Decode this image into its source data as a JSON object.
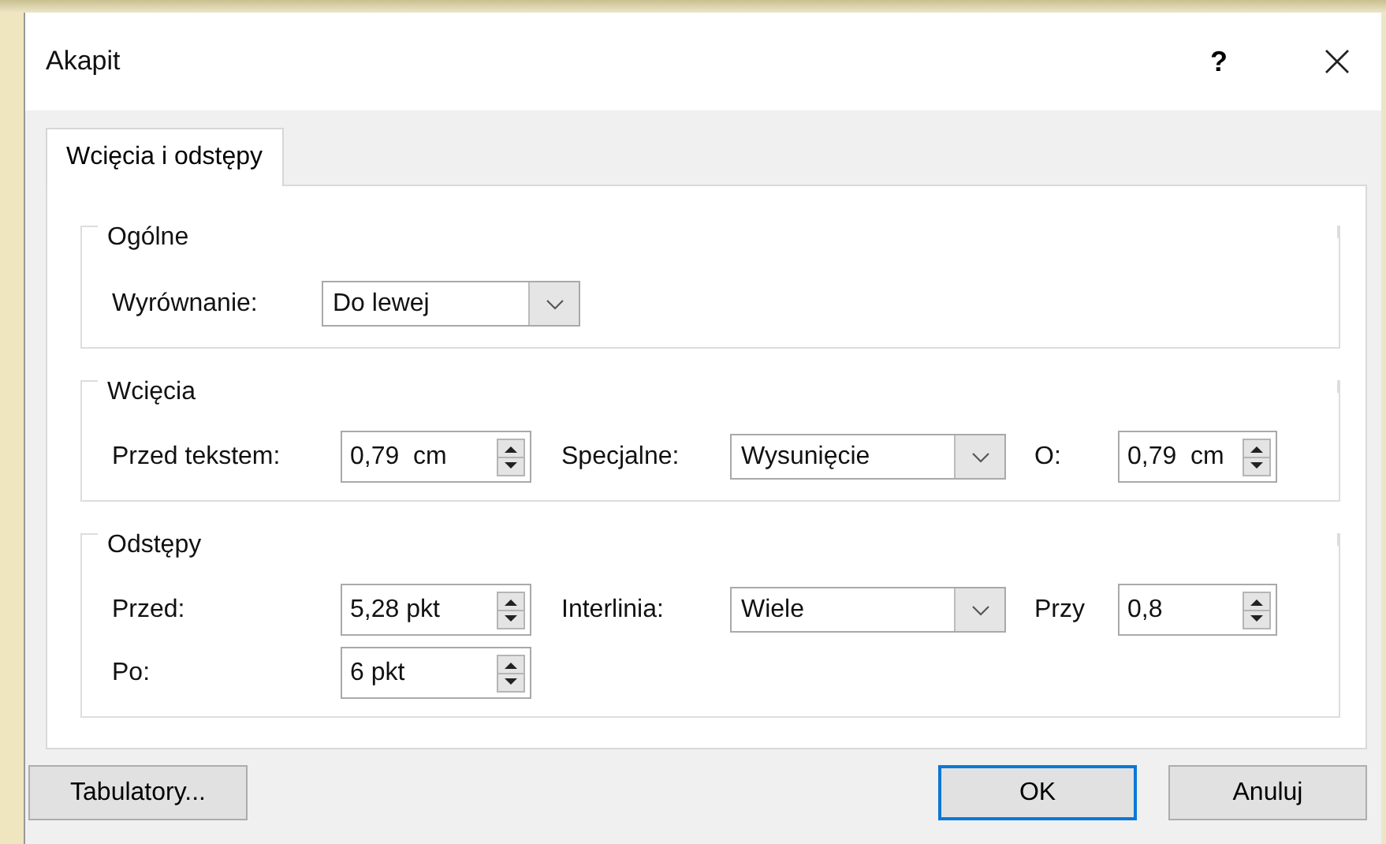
{
  "window": {
    "title": "Akapit",
    "help": "?"
  },
  "tabs": [
    {
      "label": "Wcięcia i odstępy",
      "selected": true
    }
  ],
  "groups": [
    {
      "title": "Ogólne",
      "rows": [
        [
          {
            "kind": "label",
            "text": "Wyrównanie:"
          },
          {
            "kind": "select",
            "value": "Do lewej"
          }
        ]
      ]
    },
    {
      "title": "Wcięcia",
      "rows": [
        [
          {
            "kind": "label",
            "text": "Przed tekstem:"
          },
          {
            "kind": "spin",
            "value": "0,79  cm"
          },
          {
            "kind": "gap"
          },
          {
            "kind": "label",
            "text": "Specjalne:"
          },
          {
            "kind": "select",
            "value": "Wysunięcie"
          },
          {
            "kind": "gap"
          },
          {
            "kind": "label",
            "text": "O:"
          },
          {
            "kind": "spin",
            "value": "0,79  cm"
          }
        ]
      ]
    },
    {
      "title": "Odstępy",
      "rows": [
        [
          {
            "kind": "label",
            "text": "Przed:"
          },
          {
            "kind": "spin",
            "value": "5,28 pkt"
          },
          {
            "kind": "gap"
          },
          {
            "kind": "label",
            "text": "Interlinia:"
          },
          {
            "kind": "select",
            "value": "Wiele"
          },
          {
            "kind": "gap"
          },
          {
            "kind": "label",
            "text": "Przy"
          },
          {
            "kind": "spin",
            "value": "0,8"
          }
        ],
        [
          {
            "kind": "label",
            "text": "Po:"
          },
          {
            "kind": "spin",
            "value": "6 pkt"
          }
        ]
      ]
    }
  ],
  "buttons": [
    {
      "label": "Tabulatory...",
      "default": false
    },
    {
      "label": "OK",
      "default": true
    },
    {
      "label": "Anuluj",
      "default": false
    }
  ]
}
